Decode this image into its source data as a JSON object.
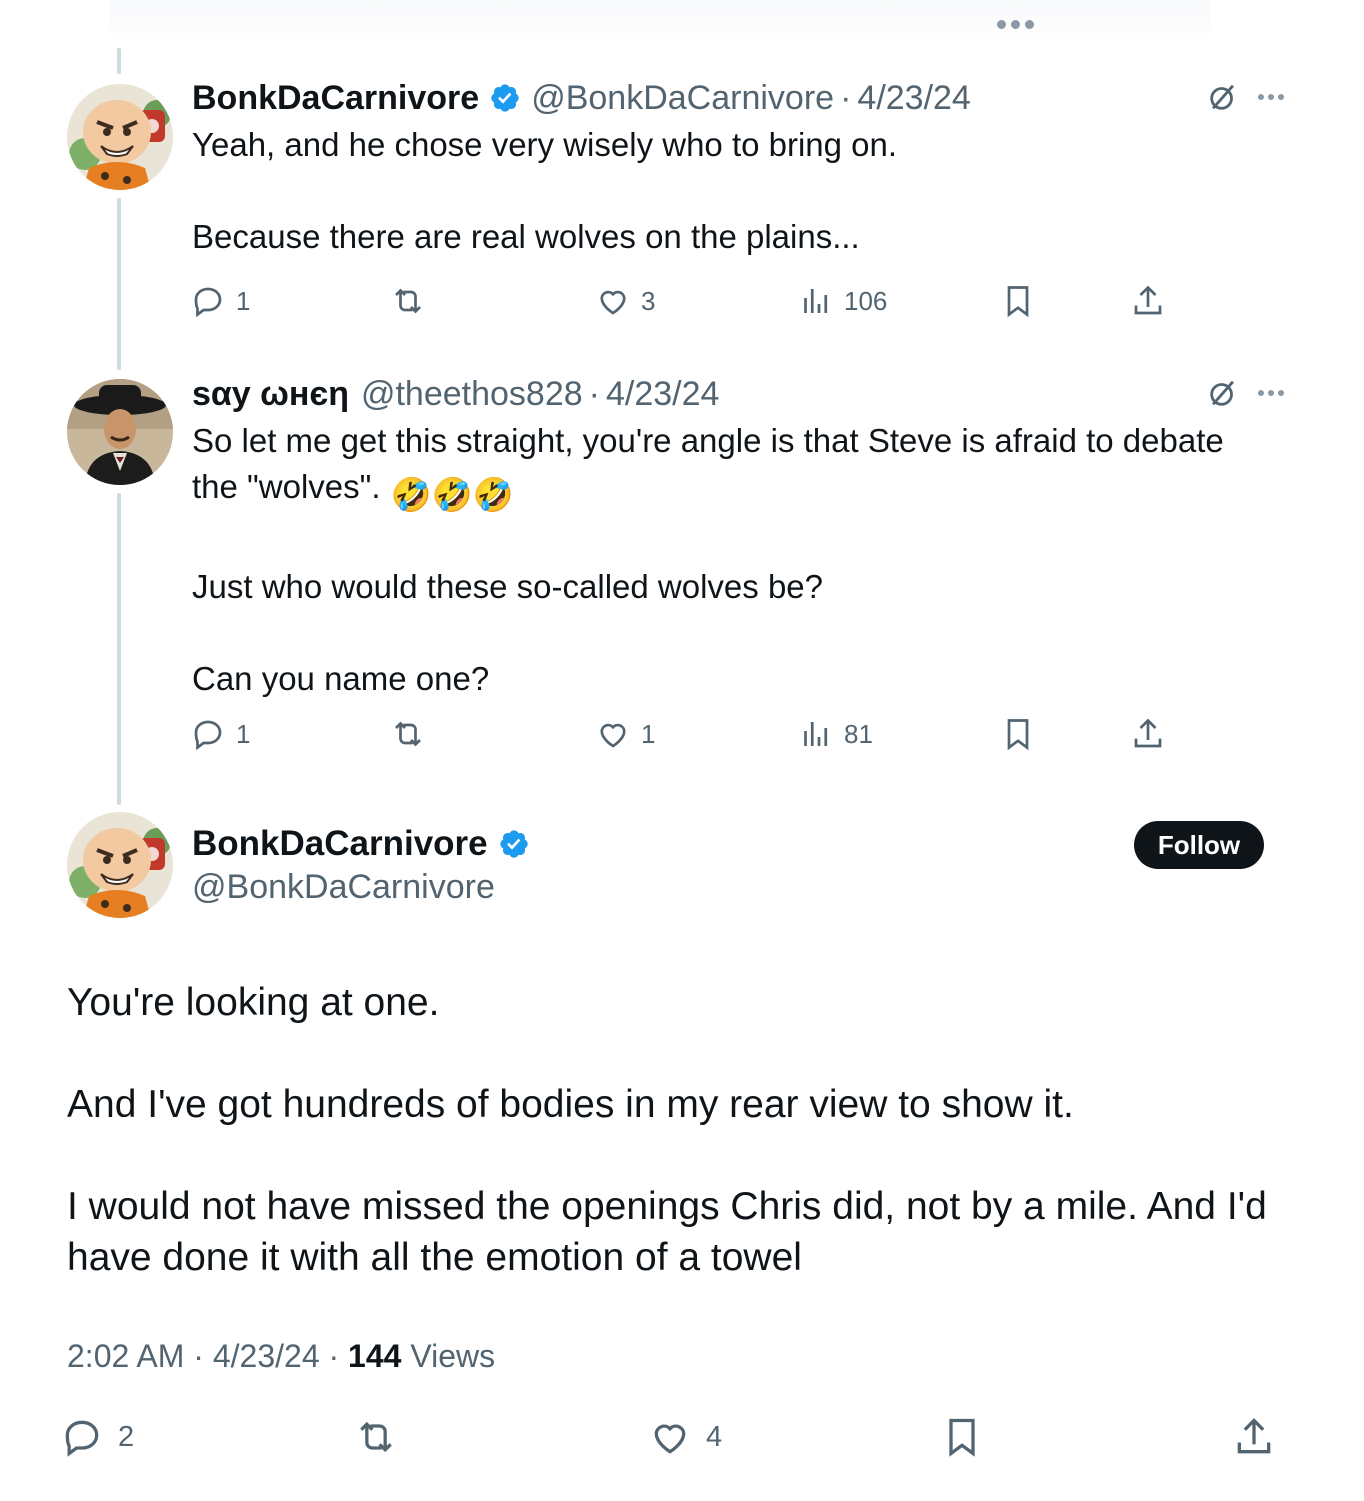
{
  "top": {
    "more_icon": "more-horizontal-icon"
  },
  "colors": {
    "verified": "#1d9bf0",
    "muted": "#536471",
    "text": "#0f1419",
    "thread_line": "#cfd9de"
  },
  "replies": [
    {
      "display_name": "BonkDaCarnivore",
      "verified": true,
      "handle": "@BonkDaCarnivore",
      "date": "4/23/24",
      "text_lines": [
        "Yeah, and he chose very wisely who to bring on.",
        "",
        "Because there are real wolves on the plains..."
      ],
      "stats": {
        "replies": "1",
        "reposts": "",
        "likes": "3",
        "views": "106"
      }
    },
    {
      "display_name": "ѕαу ωнєη",
      "verified": false,
      "handle": "@theethos828",
      "date": "4/23/24",
      "text_line1": "So let me get this straight, you're angle is that Steve is afraid to debate",
      "text_line2": "the \"wolves\".",
      "emoji": "🤣🤣🤣",
      "text_rest": "Just who would these so-called wolves be?",
      "text_last": "Can you name one?",
      "stats": {
        "replies": "1",
        "reposts": "",
        "likes": "1",
        "views": "81"
      }
    }
  ],
  "main": {
    "display_name": "BonkDaCarnivore",
    "handle": "@BonkDaCarnivore",
    "follow_label": "Follow",
    "paragraphs": [
      "You're looking at one.",
      "And I've got hundreds of bodies in my rear view to show it.",
      "I would not have missed the openings Chris did, not by a mile. And I'd have done it with all the emotion of a towel"
    ],
    "time": "2:02 AM",
    "date": "4/23/24",
    "views_count": "144",
    "views_label": "Views",
    "stats": {
      "replies": "2",
      "reposts": "",
      "likes": "4"
    }
  }
}
